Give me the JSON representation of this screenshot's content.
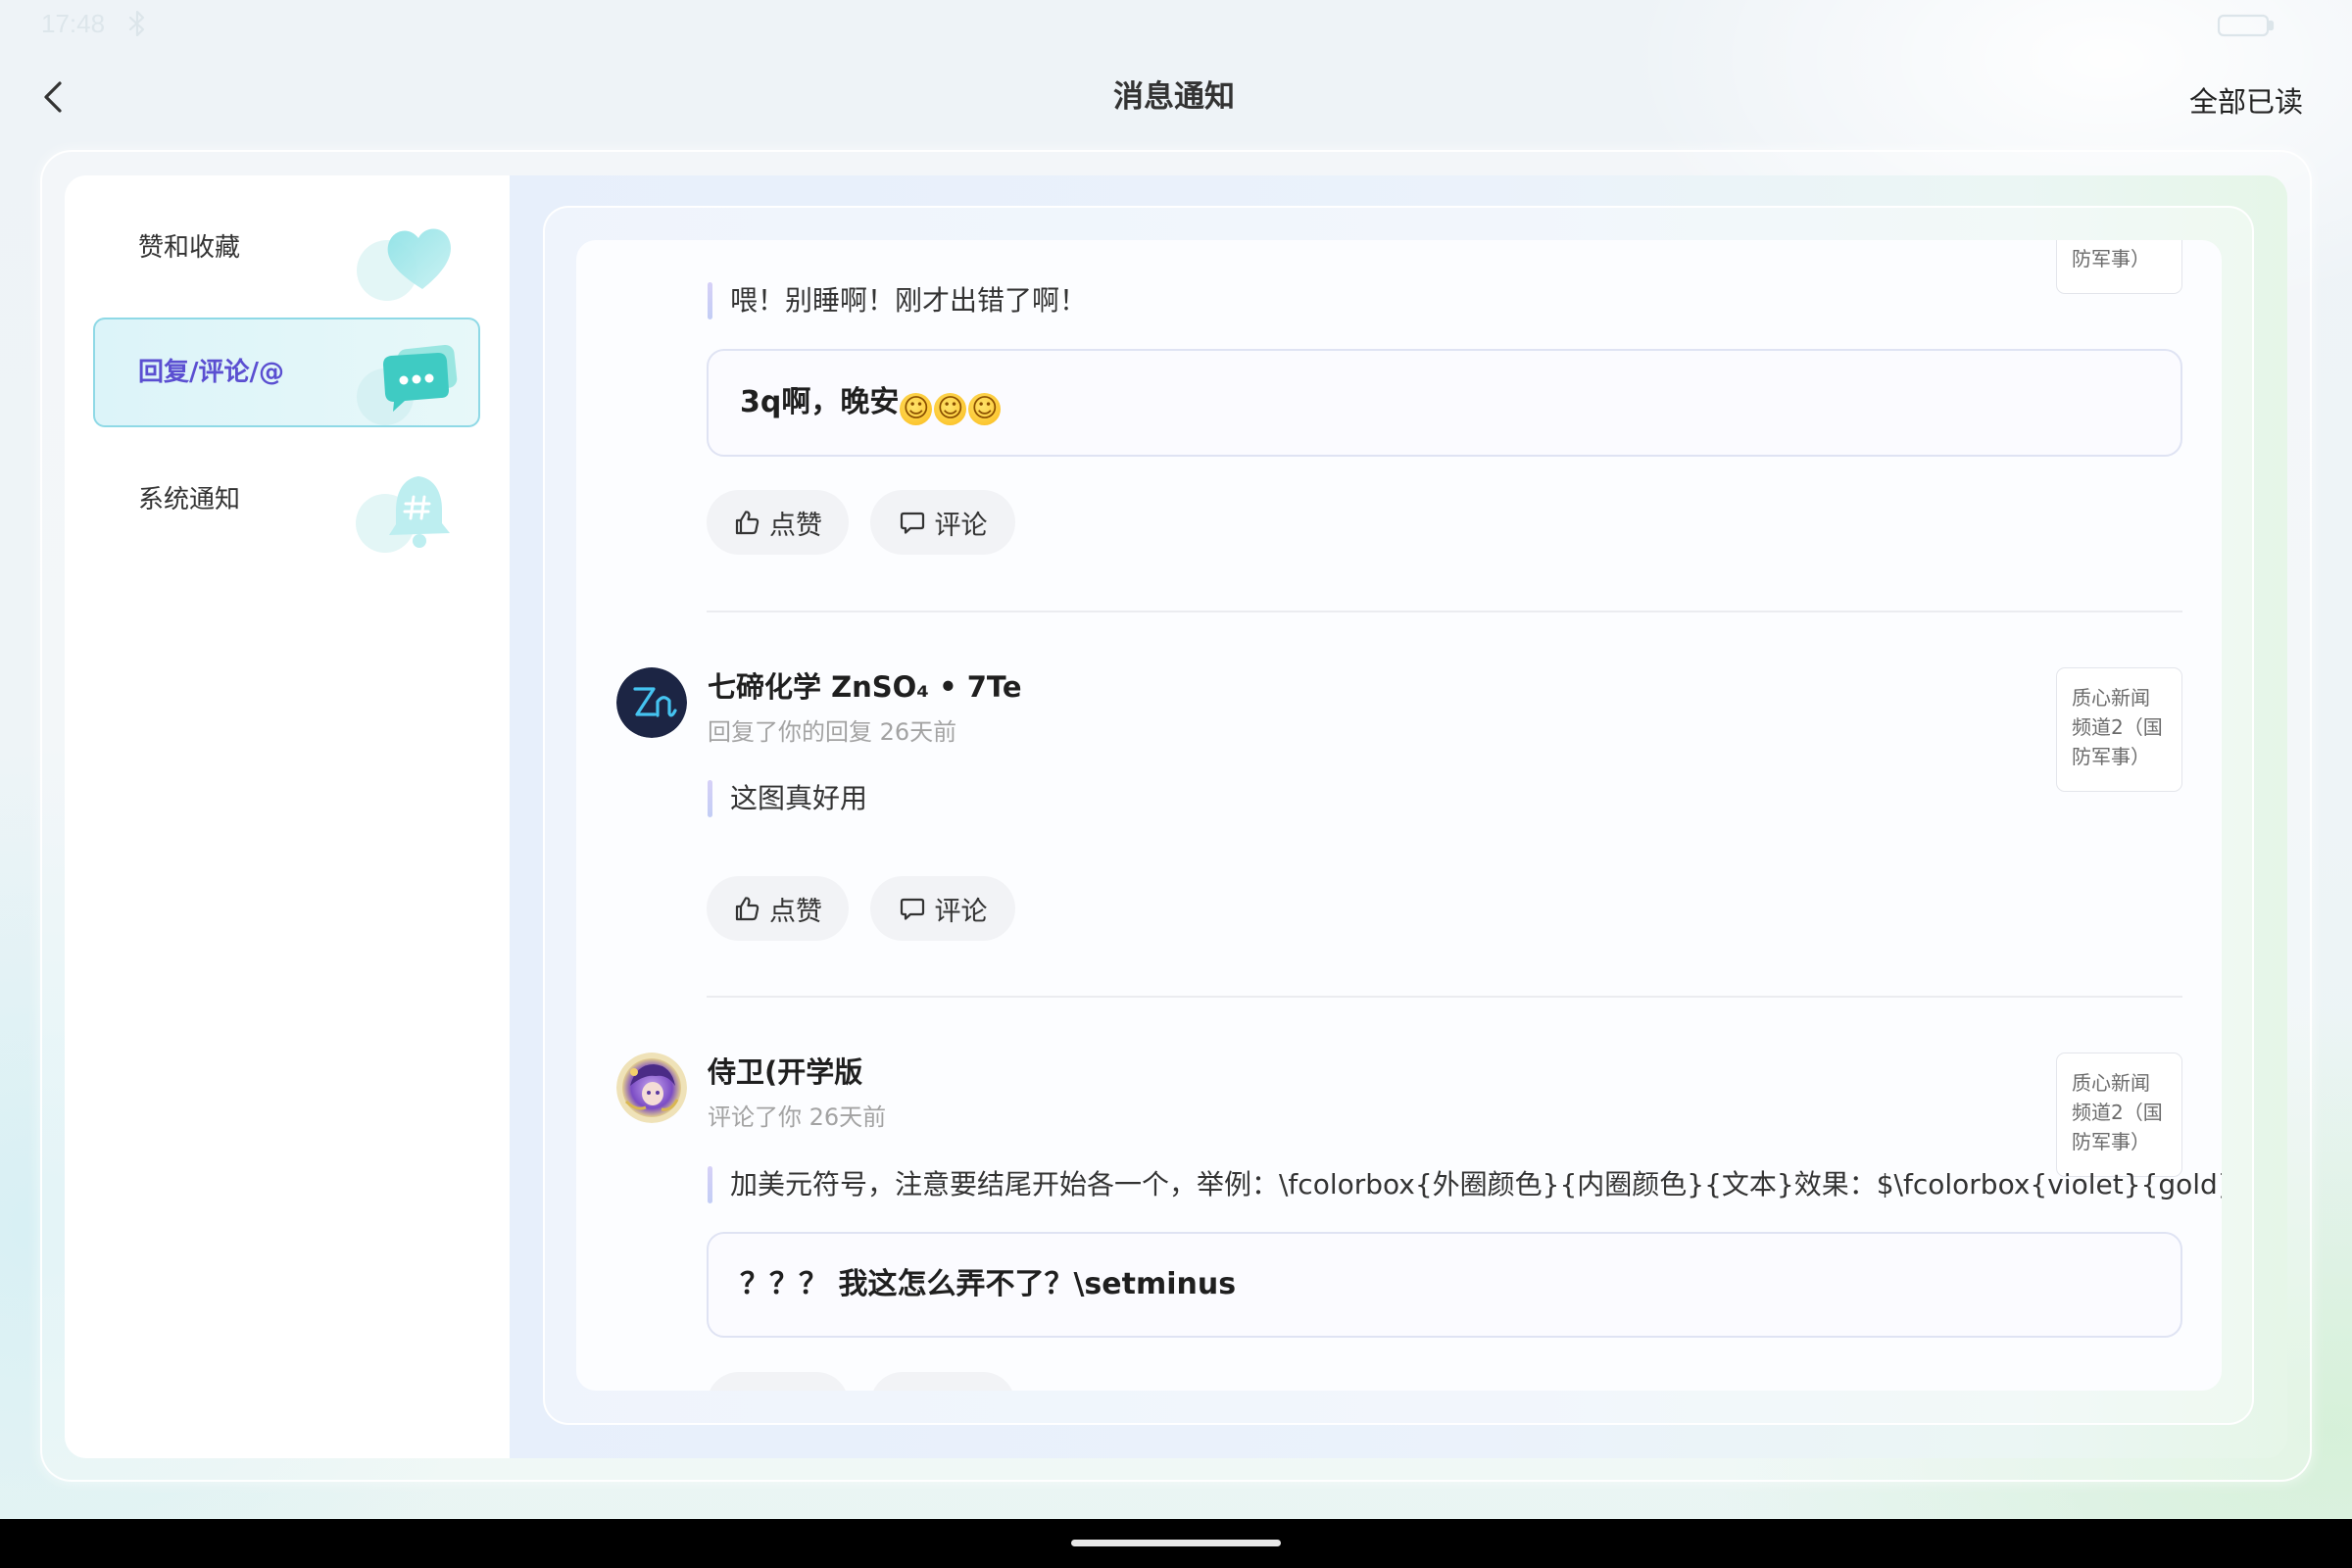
{
  "status_bar": {
    "time": "17:48",
    "icons": [
      "bluetooth-icon",
      "battery-icon"
    ]
  },
  "header": {
    "back_icon": "chevron-left-icon",
    "title": "消息通知",
    "mark_all_read": "全部已读"
  },
  "sidebar": {
    "items": [
      {
        "label": "赞和收藏",
        "icon": "heart-icon",
        "selected": false
      },
      {
        "label": "回复/评论/@",
        "icon": "chat-bubbles-icon",
        "selected": true
      },
      {
        "label": "系统通知",
        "icon": "bell-icon",
        "selected": false
      }
    ]
  },
  "actions": {
    "like_label": "点赞",
    "like_icon": "thumbs-up-icon",
    "comment_label": "评论",
    "comment_icon": "comment-icon"
  },
  "notifications": [
    {
      "badge_lines": [
        "防军事）"
      ],
      "quote": "喂！别睡啊！刚才出错了啊！",
      "reply": "3q啊，晚安☺☺☺"
    },
    {
      "avatar": "zn-logo-avatar",
      "name": "七碲化学 ZnSO₄ • 7Te",
      "meta": "回复了你的回复 26天前",
      "badge_lines": [
        "质心新闻",
        "频道2（国",
        "防军事）"
      ],
      "quote": "这图真好用"
    },
    {
      "avatar": "anime-character-avatar",
      "name": "侍卫(开学版",
      "meta": "评论了你 26天前",
      "badge_lines": [
        "质心新闻",
        "频道2（国",
        "防军事）"
      ],
      "quote": "加美元符号，注意要结尾开始各一个，举例：\\fcolorbox{外圈颜色}{内圈颜色}{文本}效果：$\\fcolorbox{violet}{gold}{我是",
      "reply": "？？？ 我这怎么弄不了？\\setminus"
    }
  ],
  "colors": {
    "accent": "#5b4fd1",
    "selected_border": "#8fd9e6",
    "quote_bar": "#cfcaf5",
    "nav_bar": "#000000"
  }
}
